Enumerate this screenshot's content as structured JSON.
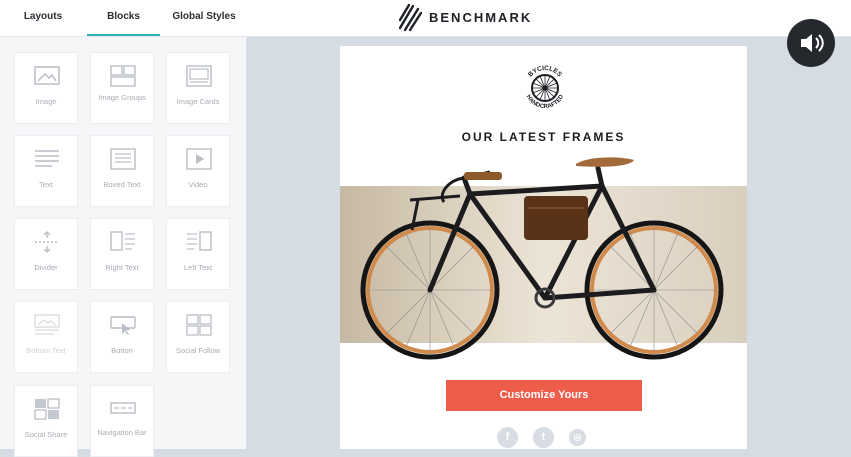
{
  "tabs": [
    {
      "label": "Layouts"
    },
    {
      "label": "Blocks",
      "active": true
    },
    {
      "label": "Global Styles"
    }
  ],
  "brand": {
    "name": "BENCHMARK"
  },
  "blocks": [
    {
      "label": "Image",
      "icon": "image-icon"
    },
    {
      "label": "Image Groups",
      "icon": "image-groups-icon"
    },
    {
      "label": "Image Cards",
      "icon": "image-cards-icon"
    },
    {
      "label": "Text",
      "icon": "text-icon"
    },
    {
      "label": "Boxed Text",
      "icon": "boxed-text-icon"
    },
    {
      "label": "Video",
      "icon": "video-icon"
    },
    {
      "label": "Divider",
      "icon": "divider-icon"
    },
    {
      "label": "Right Text",
      "icon": "right-text-icon"
    },
    {
      "label": "Left Text",
      "icon": "left-text-icon"
    },
    {
      "label": "Bottom Text",
      "icon": "bottom-text-icon"
    },
    {
      "label": "Button",
      "icon": "button-icon"
    },
    {
      "label": "Social Follow",
      "icon": "social-follow-icon"
    },
    {
      "label": "Social Share",
      "icon": "social-share-icon"
    },
    {
      "label": "Navigation Bar",
      "icon": "navigation-bar-icon"
    }
  ],
  "email": {
    "badge_top": "BYCICLES",
    "badge_bottom": "HANDCRAFTED",
    "headline": "OUR LATEST FRAMES",
    "cta_label": "Customize Yours",
    "social": [
      {
        "icon": "facebook-icon",
        "glyph": "f"
      },
      {
        "icon": "twitter-icon",
        "glyph": "t"
      },
      {
        "icon": "instagram-icon",
        "glyph": "◎"
      }
    ]
  },
  "colors": {
    "accent": "#2bb3b9",
    "cta": "#ee5c4a",
    "panel": "#f5f6f8",
    "workspace": "#d5dce4"
  }
}
